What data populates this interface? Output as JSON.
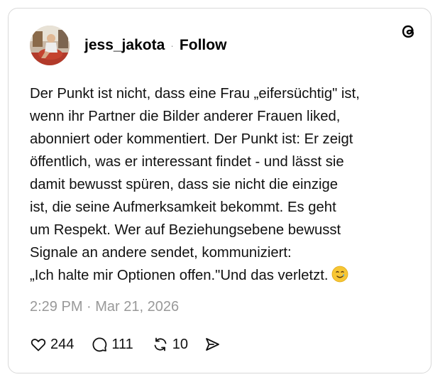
{
  "post": {
    "username": "jess_jakota",
    "separator": "·",
    "follow_label": "Follow",
    "text": "Der Punkt ist nicht, dass eine Frau „eifersüchtig\" ist,\nwenn ihr Partner die Bilder anderer Frauen liked,\nabonniert oder kommentiert. Der Punkt ist: Er zeigt\nöffentlich, was er interessant findet - und lässt sie\ndamit bewusst spüren, dass sie nicht die einzige\nist, die seine Aufmerksamkeit bekommt. Es geht\num Respekt. Wer auf Beziehungsebene bewusst\nSignale an andere sendet, kommuniziert:\n„Ich halte mir Optionen offen.\"Und das verletzt.",
    "emoji": "smiling-face-with-tear",
    "timestamp": "2:29 PM · Mar 21, 2026",
    "likes": "244",
    "replies": "111",
    "reposts": "10"
  },
  "icons": {
    "logo": "threads-logo-icon",
    "like": "heart-icon",
    "reply": "comment-bubble-icon",
    "repost": "repost-icon",
    "share": "send-icon"
  }
}
